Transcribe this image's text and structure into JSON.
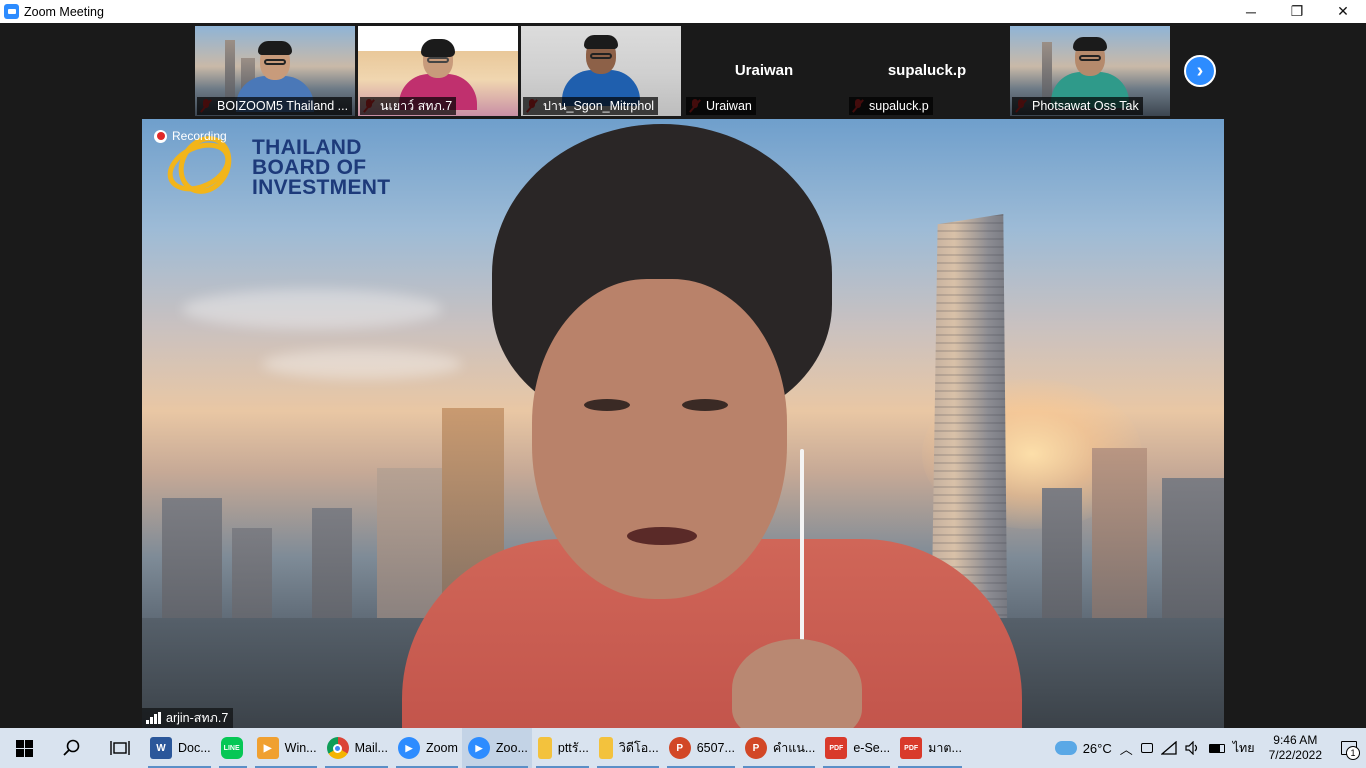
{
  "window": {
    "title": "Zoom Meeting",
    "controls": [
      "─",
      "❐",
      "✕"
    ]
  },
  "gallery": {
    "participants": [
      {
        "name": "BOIZOOM5 Thailand ...",
        "muted": true,
        "video": "city"
      },
      {
        "name": "นเยาว์ สทภ.7",
        "muted": true,
        "video": "slide"
      },
      {
        "name": "ปาน_Sgon_Mitrphol",
        "muted": true,
        "video": "room"
      },
      {
        "name": "Uraiwan",
        "muted": true,
        "video": "none",
        "display_name": "Uraiwan"
      },
      {
        "name": "supaluck.p",
        "muted": true,
        "video": "none",
        "display_name": "supaluck.p"
      },
      {
        "name": "Photsawat Oss Tak",
        "muted": true,
        "video": "city"
      }
    ],
    "next_icon": "›"
  },
  "main": {
    "speaker_name": "arjin-สทภ.7",
    "recording_label": "Recording",
    "logo": {
      "line1": "THAILAND",
      "line2": "BOARD OF",
      "line3": "INVESTMENT"
    },
    "brand_colors": {
      "logo_text": "#1d3a7a",
      "logo_mark": "#f2b51a",
      "zoom_blue": "#2d8cff",
      "mute_red": "#e02828"
    }
  },
  "taskbar": {
    "apps": [
      {
        "label": "Doc...",
        "icon": "word-icon",
        "color": "#2b579a",
        "glyph": "W"
      },
      {
        "label": "",
        "icon": "line-icon",
        "color": "#06c755",
        "glyph": "LINE"
      },
      {
        "label": "Win...",
        "icon": "media-player-icon",
        "color": "#f0a030",
        "glyph": "▶"
      },
      {
        "label": "Mail...",
        "icon": "chrome-icon",
        "color": "#4285f4",
        "glyph": "●"
      },
      {
        "label": "Zoom",
        "icon": "zoom-icon",
        "color": "#2d8cff",
        "glyph": "▶"
      },
      {
        "label": "Zoo...",
        "icon": "zoom-icon",
        "color": "#2d8cff",
        "glyph": "▶"
      },
      {
        "label": "pttรั...",
        "icon": "folder-icon",
        "color": "#f3c23d",
        "glyph": ""
      },
      {
        "label": "วิดีโอ...",
        "icon": "folder-icon",
        "color": "#f3c23d",
        "glyph": ""
      },
      {
        "label": "6507...",
        "icon": "powerpoint-icon",
        "color": "#d24726",
        "glyph": "P"
      },
      {
        "label": "คำแน...",
        "icon": "powerpoint-icon",
        "color": "#d24726",
        "glyph": "P"
      },
      {
        "label": "e-Se...",
        "icon": "pdf-icon",
        "color": "#d93a2b",
        "glyph": "PDF"
      },
      {
        "label": "มาต...",
        "icon": "pdf-icon",
        "color": "#d93a2b",
        "glyph": "PDF"
      }
    ],
    "weather": "26°C",
    "language": "ไทย",
    "time": "9:46 AM",
    "date": "7/22/2022",
    "notifications": "1"
  }
}
